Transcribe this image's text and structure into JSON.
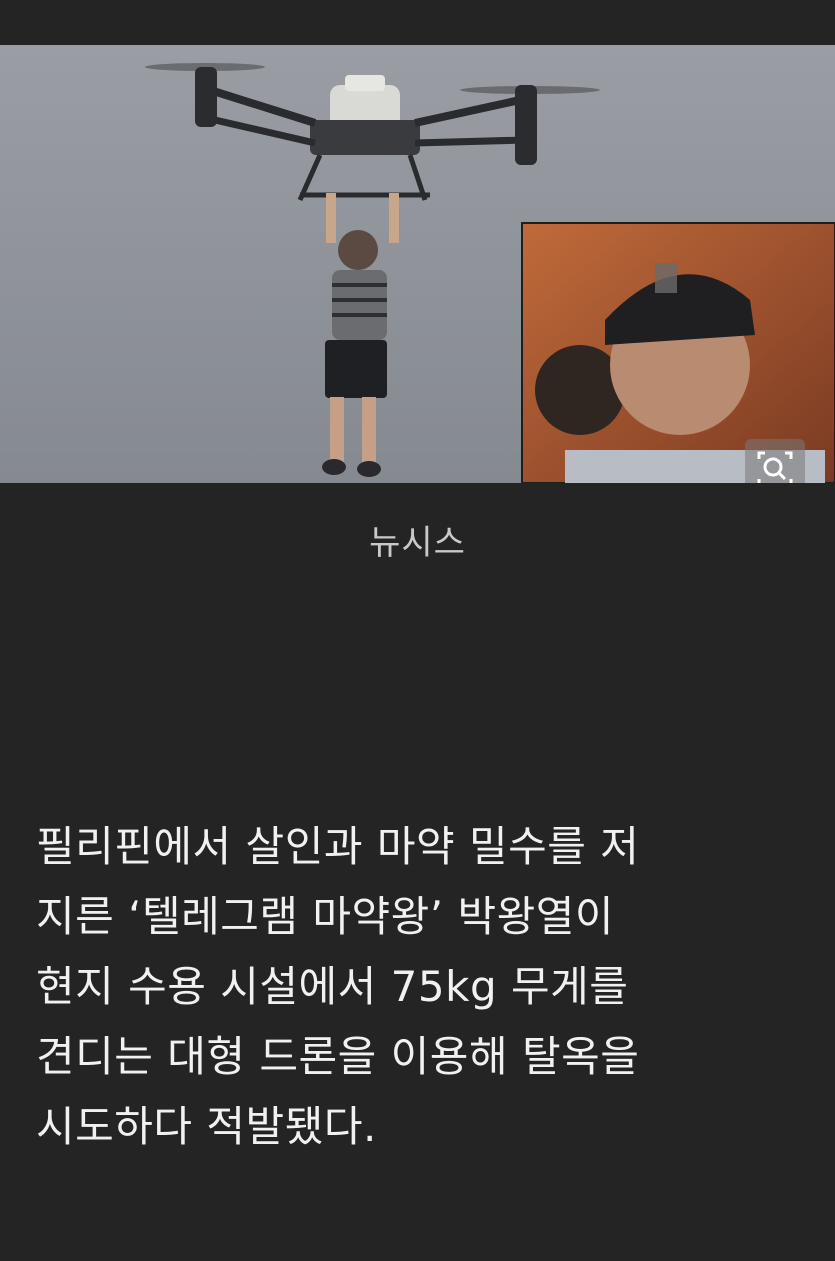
{
  "figure": {
    "caption": "뉴시스",
    "main_photo": "drone-lifting-person",
    "inset_photo": "man-in-cap-with-blurred-logo",
    "zoom_icon": "magnify-icon"
  },
  "article": {
    "body": "필리핀에서 살인과 마약 밀수를 저\n지른 ‘텔레그램 마약왕’ 박왕열이\n현지 수용 시설에서 75kg 무게를\n견디는 대형 드론을 이용해 탈옥을\n시도하다 적발됐다."
  },
  "colors": {
    "background": "#242424",
    "caption": "#c9c9c9",
    "body_text": "#f1f1f1",
    "sky": "#8f9399"
  }
}
